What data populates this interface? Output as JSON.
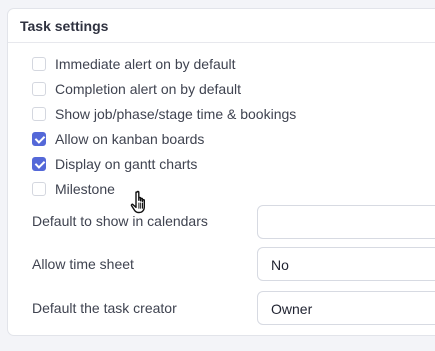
{
  "panel": {
    "title": "Task settings"
  },
  "checkboxes": [
    {
      "label": "Immediate alert on by default",
      "checked": false
    },
    {
      "label": "Completion alert on by default",
      "checked": false
    },
    {
      "label": "Show job/phase/stage time & bookings",
      "checked": false
    },
    {
      "label": "Allow on kanban boards",
      "checked": true
    },
    {
      "label": "Display on gantt charts",
      "checked": true
    },
    {
      "label": "Milestone",
      "checked": false
    }
  ],
  "fields": {
    "calendar": {
      "label": "Default to show in calendars",
      "value": ""
    },
    "timesheet": {
      "label": "Allow time sheet",
      "value": "No"
    },
    "creator": {
      "label": "Default the task creator",
      "value": "Owner"
    }
  },
  "colors": {
    "accent": "#5468d8",
    "background": "#f3f4f8",
    "panel": "#ffffff"
  },
  "icons": {
    "cursor": "pointer-hand-icon"
  }
}
